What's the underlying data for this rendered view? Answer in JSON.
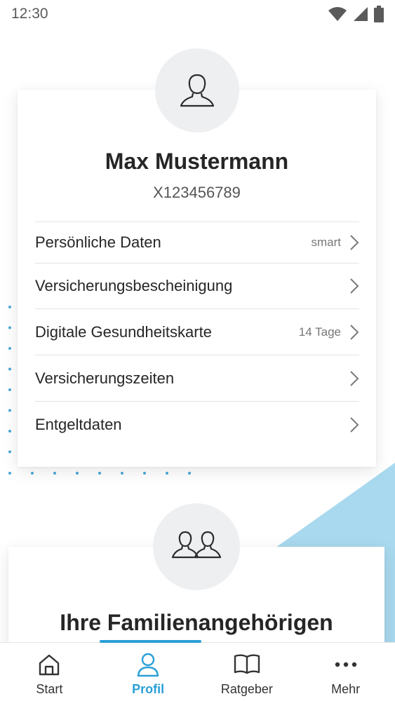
{
  "status_bar": {
    "time": "12:30"
  },
  "profile": {
    "name": "Max Mustermann",
    "id": "X123456789",
    "avatar_icon": "person-icon"
  },
  "menu": {
    "items": [
      {
        "label": "Persönliche Daten",
        "badge": "smart"
      },
      {
        "label": "Versicherungsbescheinigung",
        "badge": ""
      },
      {
        "label": "Digitale Gesundheitskarte",
        "badge": "14 Tage"
      },
      {
        "label": "Versicherungszeiten",
        "badge": ""
      },
      {
        "label": "Entgeltdaten",
        "badge": ""
      }
    ]
  },
  "family": {
    "title": "Ihre Familienangehörigen",
    "avatar_icon": "people-icon"
  },
  "bottom_nav": {
    "items": [
      {
        "label": "Start",
        "icon": "home-icon"
      },
      {
        "label": "Profil",
        "icon": "person-icon",
        "active": true
      },
      {
        "label": "Ratgeber",
        "icon": "book-icon"
      },
      {
        "label": "Mehr",
        "icon": "more-icon"
      }
    ]
  },
  "colors": {
    "accent": "#2a9fd6",
    "wave": "#a9d9ee",
    "dots": "#4aa8d8",
    "avatar_bg": "#eeeff1"
  }
}
